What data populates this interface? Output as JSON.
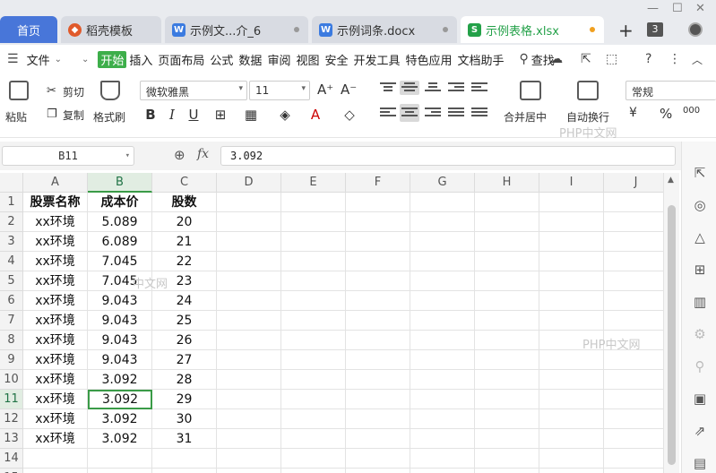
{
  "tabs": [
    {
      "label": "首页"
    },
    {
      "label": "稻壳模板",
      "icon": "daoke-icon",
      "color": "#e05a2b"
    },
    {
      "label": "示例文...介_6",
      "icon": "wps-writer-icon",
      "color": "#3b7be0"
    },
    {
      "label": "示例词条.docx",
      "icon": "wps-writer-icon",
      "color": "#3b7be0"
    },
    {
      "label": "示例表格.xlsx",
      "icon": "wps-sheet-icon",
      "color": "#24a149"
    }
  ],
  "window": {
    "tab_count": "3"
  },
  "menu": {
    "file": "文件",
    "items": [
      "开始",
      "插入",
      "页面布局",
      "公式",
      "数据",
      "审阅",
      "视图",
      "安全",
      "开发工具",
      "特色应用",
      "文档助手"
    ],
    "search": "查找"
  },
  "ribbon": {
    "paste": "粘贴",
    "cut": "剪切",
    "copy": "复制",
    "format_painter": "格式刷",
    "font_name": "微软雅黑",
    "font_size": "11",
    "merge_center": "合并居中",
    "wrap_text": "自动换行",
    "number_format": "常规"
  },
  "formula_bar": {
    "cell_ref": "B11",
    "fx": "fx",
    "value": "3.092"
  },
  "sheet": {
    "columns": [
      "A",
      "B",
      "C",
      "D",
      "E",
      "F",
      "G",
      "H",
      "I",
      "J"
    ],
    "selected_column": "B",
    "selected_row": "11",
    "headers": [
      "股票名称",
      "成本价",
      "股数"
    ],
    "rows": [
      [
        "xx环境",
        "5.089",
        "20"
      ],
      [
        "xx环境",
        "6.089",
        "21"
      ],
      [
        "xx环境",
        "7.045",
        "22"
      ],
      [
        "xx环境",
        "7.045",
        "23"
      ],
      [
        "xx环境",
        "9.043",
        "24"
      ],
      [
        "xx环境",
        "9.043",
        "25"
      ],
      [
        "xx环境",
        "9.043",
        "26"
      ],
      [
        "xx环境",
        "9.043",
        "27"
      ],
      [
        "xx环境",
        "3.092",
        "28"
      ],
      [
        "xx环境",
        "3.092",
        "29"
      ],
      [
        "xx环境",
        "3.092",
        "30"
      ],
      [
        "xx环境",
        "3.092",
        "31"
      ]
    ],
    "row_numbers": [
      "1",
      "2",
      "3",
      "4",
      "5",
      "6",
      "7",
      "8",
      "9",
      "10",
      "11",
      "12",
      "13",
      "14",
      "15"
    ]
  },
  "watermarks": [
    "PHP中文网",
    "中文网",
    "PHP中文网"
  ]
}
